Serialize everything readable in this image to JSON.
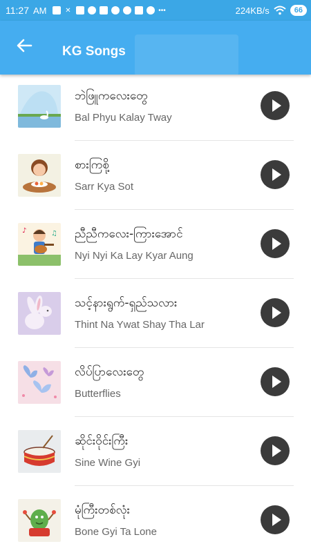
{
  "status_bar": {
    "time": "11:27",
    "ampm": "AM",
    "speed": "224KB/s",
    "battery": "66",
    "icons": [
      "upload-icon",
      "close-icon",
      "play-store-icon",
      "bubble-icon",
      "gamepad-icon",
      "check-icon",
      "facebook-icon",
      "app-icon",
      "vpn-icon",
      "dots-icon",
      "wifi-icon",
      "battery-icon"
    ]
  },
  "app_bar": {
    "title": "KG Songs",
    "back_icon": "arrow-left-icon"
  },
  "songs": [
    {
      "title_mm": "ဘဲဖြူကလေးတွေ",
      "title_en": "Bal Phyu Kalay Tway",
      "thumb": "swan-pond-thumbnail"
    },
    {
      "title_mm": "စားကြစို့",
      "title_en": "Sarr Kya Sot",
      "thumb": "girl-eating-thumbnail"
    },
    {
      "title_mm": "ညီညီကလေး-ကြားအောင်",
      "title_en": "Nyi Nyi Ka Lay Kyar Aung",
      "thumb": "boy-guitar-thumbnail"
    },
    {
      "title_mm": "သင့်နားရွက်-ရှည်သလား",
      "title_en": "Thint Na Ywat Shay Tha Lar",
      "thumb": "rabbit-thumbnail"
    },
    {
      "title_mm": "လိပ်ပြာလေးတွေ",
      "title_en": "Butterflies",
      "thumb": "butterflies-thumbnail"
    },
    {
      "title_mm": "ဆိုင်းဝိုင်းကြီး",
      "title_en": "Sine Wine Gyi",
      "thumb": "drum-thumbnail"
    },
    {
      "title_mm": "မုံကြီးတစ်လုံး",
      "title_en": "Bone Gyi Ta Lone",
      "thumb": "monster-drum-thumbnail"
    }
  ],
  "colors": {
    "status_bar": "#3ba7e6",
    "app_bar": "#45adf0",
    "play_button": "#3b3b3b"
  }
}
